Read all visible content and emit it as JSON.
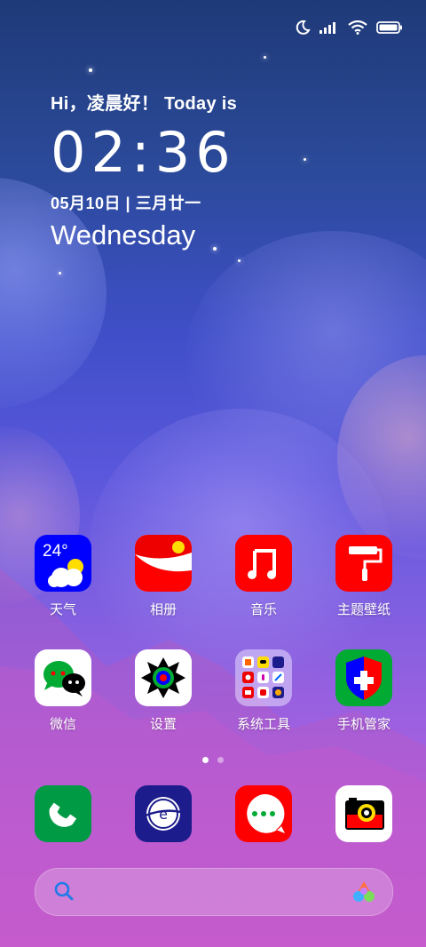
{
  "status": {
    "icons": [
      "moon-icon",
      "signal-icon",
      "wifi-icon",
      "battery-icon"
    ]
  },
  "widget": {
    "greeting": "Hi，凌晨好！ Today is",
    "time": "02:36",
    "date": "05月10日 | 三月廿一",
    "weekday": "Wednesday"
  },
  "apps": {
    "weather": {
      "label": "天气",
      "temp": "24°"
    },
    "gallery": {
      "label": "相册"
    },
    "music": {
      "label": "音乐"
    },
    "themes": {
      "label": "主题壁纸"
    },
    "wechat": {
      "label": "微信"
    },
    "settings": {
      "label": "设置"
    },
    "tools": {
      "label": "系统工具"
    },
    "security": {
      "label": "手机管家"
    }
  },
  "dock": [
    "phone-icon",
    "browser-icon",
    "messages-icon",
    "camera-icon"
  ],
  "pages": {
    "count": 2,
    "active": 1
  },
  "search": {
    "placeholder": ""
  },
  "colors": {
    "red": "#ff0000",
    "blue": "#0000ff",
    "green": "#009944",
    "navy": "#1c1c8c"
  }
}
